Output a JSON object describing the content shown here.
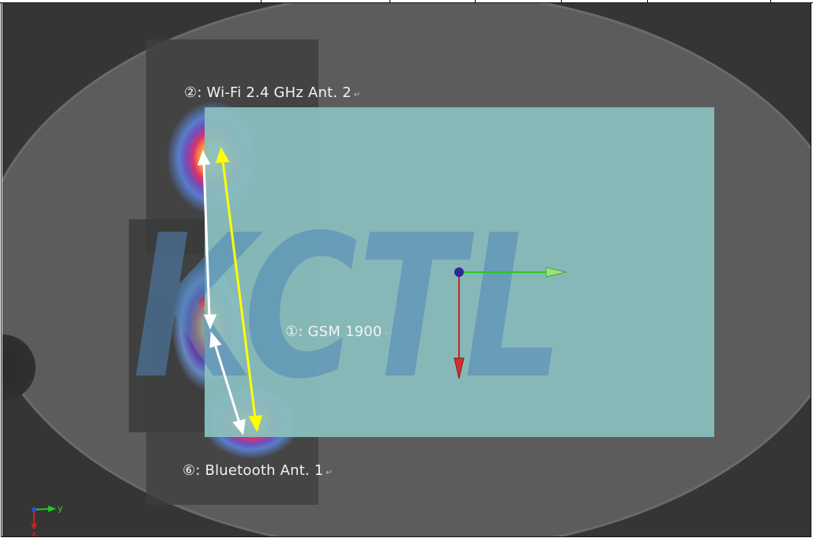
{
  "watermark": "KCTL",
  "labels": {
    "wifi": "②: Wi-Fi 2.4 GHz Ant. 2",
    "gsm": "①: GSM 1900",
    "bluetooth": "⑥: Bluetooth Ant. 1",
    "return_mark": "↵"
  },
  "axis_indicator": {
    "y_label": "y",
    "x_label": "x"
  },
  "colors": {
    "background": "#353535",
    "ellipse": "#5c5c5c",
    "phone_region": "#8bbfbf",
    "watermark": "#4f86b8",
    "arrow_white": "#ffffff",
    "arrow_yellow": "#ffff00",
    "axis_green": "#22cc22",
    "axis_red": "#cc2222",
    "origin_blue": "#2a2a9a"
  },
  "icons": [
    "coordinate-axes-icon",
    "origin-sphere-icon",
    "mini-axis-triad-icon"
  ]
}
